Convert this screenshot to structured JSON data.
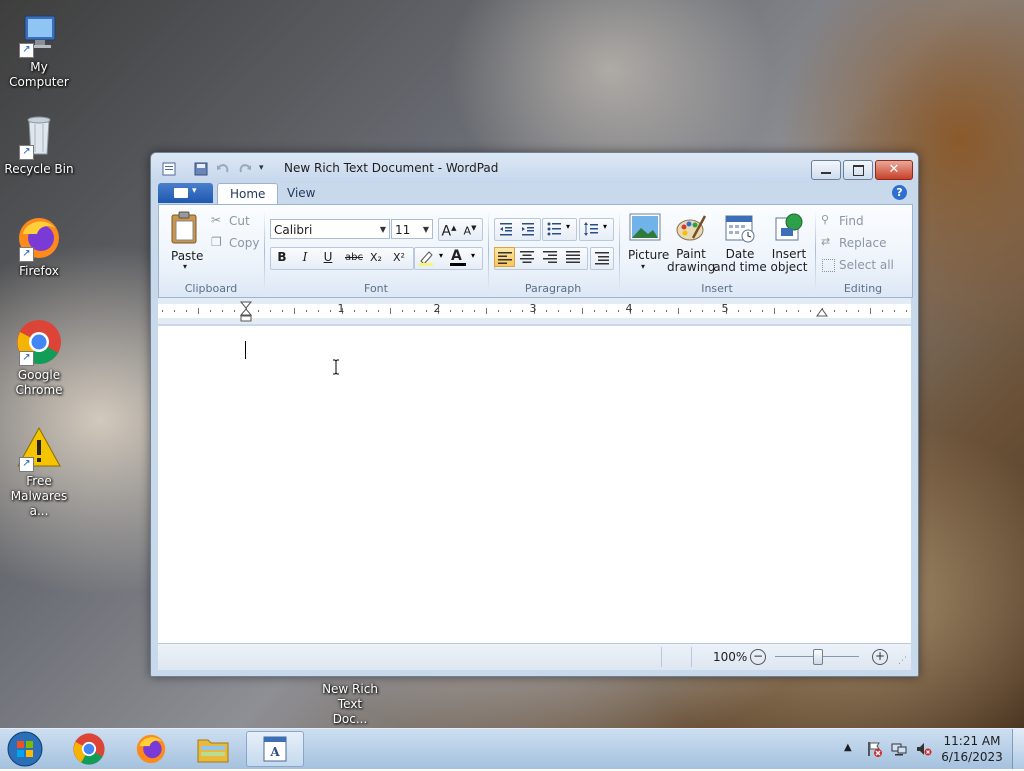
{
  "desktop": {
    "icons": [
      {
        "label": "My Computer"
      },
      {
        "label": "Recycle Bin"
      },
      {
        "label": "Firefox"
      },
      {
        "label": "Google Chrome"
      },
      {
        "label": "Free Malwares a..."
      },
      {
        "label": "New Rich Text Doc..."
      }
    ]
  },
  "window": {
    "title": "New Rich Text Document - WordPad",
    "tabs": [
      "Home",
      "View"
    ],
    "clipboard": {
      "paste": "Paste",
      "cut": "Cut",
      "copy": "Copy",
      "group": "Clipboard"
    },
    "font": {
      "family": "Calibri",
      "size": "11",
      "group": "Font",
      "bold": "B",
      "italic": "I",
      "underline": "U",
      "strike": "abc",
      "subscript": "X₂",
      "superscript": "X²",
      "grow": "A",
      "shrink": "A"
    },
    "paragraph": {
      "group": "Paragraph"
    },
    "insert": {
      "picture": "Picture",
      "paint_drawing": "Paint drawing",
      "date_time": "Date and time",
      "insert_object": "Insert object",
      "group": "Insert"
    },
    "editing": {
      "find": "Find",
      "replace": "Replace",
      "select_all": "Select all",
      "group": "Editing"
    },
    "ruler_numbers": [
      "1",
      "2",
      "3",
      "4",
      "5"
    ],
    "status": {
      "zoom": "100%"
    }
  },
  "taskbar": {
    "time": "11:21 AM",
    "date": "6/16/2023"
  },
  "colors": {
    "accent": "#1f58b0",
    "highlight": "#f7c75a"
  }
}
